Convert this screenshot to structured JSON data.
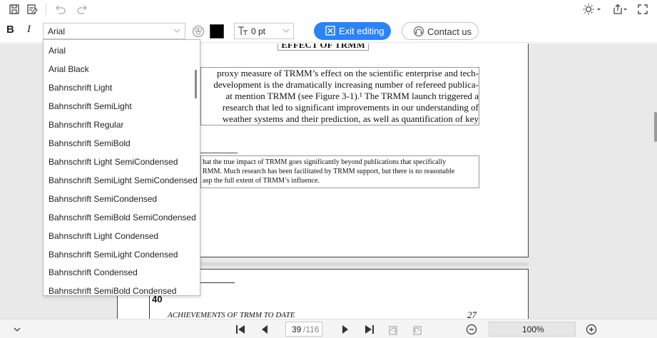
{
  "toolbar": {
    "icons": [
      "save-icon",
      "save-as-icon",
      "undo-icon",
      "redo-icon",
      "theme-icon",
      "share-icon",
      "fullscreen-icon"
    ]
  },
  "format": {
    "bold_label": "B",
    "italic_label": "I",
    "font_value": "Arial",
    "font_size_prefix": "TT",
    "font_size_value": "0 pt",
    "text_color": "#000000",
    "exit_label": "Exit editing",
    "contact_label": "Contact us",
    "accent": "#2b83f6"
  },
  "font_dropdown": {
    "items": [
      "Arial",
      "Arial Black",
      "Bahnschrift Light",
      "Bahnschrift SemiLight",
      "Bahnschrift Regular",
      "Bahnschrift SemiBold",
      "Bahnschrift Light SemiCondensed",
      "Bahnschrift SemiLight SemiCondensed",
      "Bahnschrift SemiCondensed",
      "Bahnschrift SemiBold SemiCondensed",
      "Bahnschrift Light Condensed",
      "Bahnschrift SemiLight Condensed",
      "Bahnschrift Condensed",
      "Bahnschrift SemiBold Condensed"
    ]
  },
  "document": {
    "heading": "EFFECT OF TRMM",
    "para_lines": [
      "proxy measure of TRMM’s effect on the scientific enterprise and tech-",
      "development is the dramatically increasing number of refereed publica-",
      "at mention TRMM (see Figure 3-1).¹  The TRMM launch triggered a",
      "research that led to significant improvements in our understanding of",
      "weather systems and their prediction, as well as quantification of key"
    ],
    "foot_lines": [
      "hat the true impact of TRMM goes significantly beyond publications that specifically",
      "RMM. Much research has been facilitated by TRMM support, but there is no reasonable",
      "asp the full extent of TRMM’s influence."
    ],
    "page2_number": "40",
    "running_head": "ACHIEVEMENTS OF TRMM TO DATE",
    "running_number": "27"
  },
  "navigation": {
    "current_page": "39",
    "total_pages": "/116",
    "zoom": "100%"
  }
}
